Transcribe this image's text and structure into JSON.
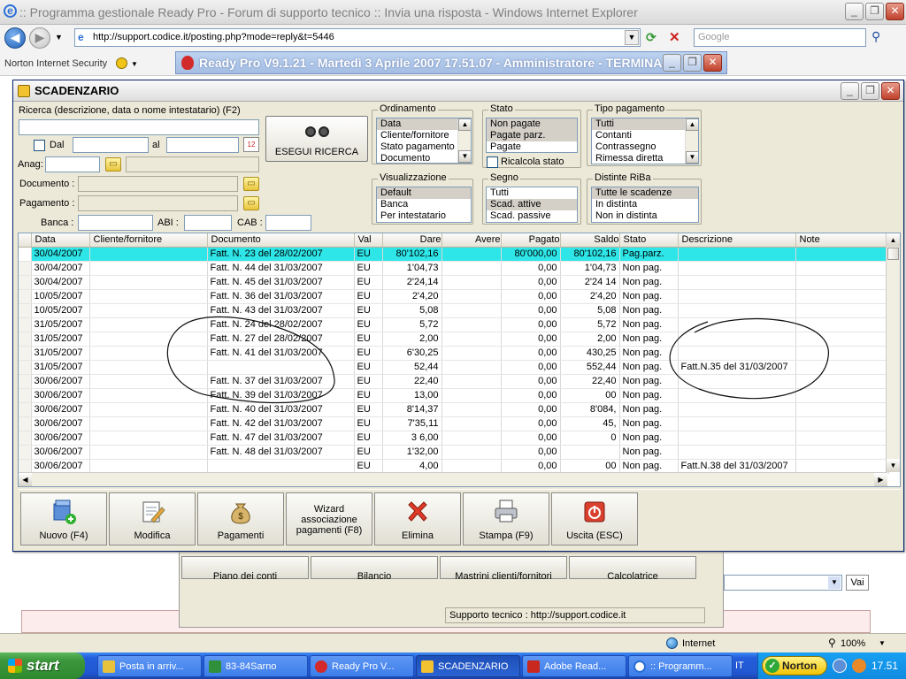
{
  "ie": {
    "title": ":: Programma gestionale Ready Pro - Forum di supporto tecnico :: Invia una risposta - Windows Internet Explorer",
    "url": "http://support.codice.it/posting.php?mode=reply&t=5446",
    "search_placeholder": "Google",
    "norton_label": "Norton Internet Security",
    "status_zone": "Internet",
    "zoom": "100%"
  },
  "readypro": {
    "title": "Ready Pro V9.1.21 - Martedì 3 Aprile 2007  17.51.07 - Amministratore - TERMINA...",
    "behind_buttons": [
      "Piano dei conti",
      "Bilancio",
      "Mastrini clienti/fornitori",
      "Calcolatrice"
    ],
    "support_text": "Supporto tecnico : http://support.codice.it",
    "vai_label": "Vai"
  },
  "window": {
    "title": "SCADENZARIO"
  },
  "filters": {
    "search_label": "Ricerca (descrizione, data o nome intestatario) (F2)",
    "dal_label": "Dal",
    "al_label": "al",
    "anag_label": "Anag:",
    "documento_label": "Documento :",
    "pagamento_label": "Pagamento :",
    "banca_label": "Banca :",
    "abi_label": "ABI :",
    "cab_label": "CAB :",
    "search_button": "ESEGUI RICERCA",
    "ricalcola_label": "Ricalcola stato"
  },
  "ordinamento": {
    "caption": "Ordinamento",
    "items": [
      "Data",
      "Cliente/fornitore",
      "Stato pagamento",
      "Documento"
    ],
    "selected": 0
  },
  "stato": {
    "caption": "Stato",
    "items": [
      "Non pagate",
      "Pagate parz.",
      "Pagate"
    ],
    "selected": [
      0,
      1
    ]
  },
  "tipo_pagamento": {
    "caption": "Tipo pagamento",
    "items": [
      "Tutti",
      "Contanti",
      "Contrassegno",
      "Rimessa diretta"
    ],
    "selected": 0
  },
  "visualizzazione": {
    "caption": "Visualizzazione",
    "items": [
      "Default",
      "Banca",
      "Per intestatario"
    ],
    "selected": 0
  },
  "segno": {
    "caption": "Segno",
    "items": [
      "Tutti",
      "Scad. attive",
      "Scad. passive"
    ],
    "selected": 1
  },
  "distinte": {
    "caption": "Distinte RiBa",
    "items": [
      "Tutte le scadenze",
      "In distinta",
      "Non in distinta"
    ],
    "selected": 0
  },
  "table": {
    "columns": [
      "Data",
      "Cliente/fornitore",
      "Documento",
      "Val",
      "Dare",
      "Avere",
      "Pagato",
      "Saldo",
      "Stato",
      "Descrizione",
      "Note"
    ],
    "rows": [
      {
        "data": "30/04/2007",
        "cliente": "",
        "doc": "Fatt. N. 23 del 28/02/2007",
        "val": "EU",
        "dare": "80'102,16",
        "avere": "",
        "pagato": "80'000,00",
        "saldo": "80'102,16",
        "stato": "Pag.parz.",
        "descr": "",
        "note": ""
      },
      {
        "data": "30/04/2007",
        "cliente": "",
        "doc": "Fatt. N. 44 del 31/03/2007",
        "val": "EU",
        "dare": "1'04,73",
        "avere": "",
        "pagato": "0,00",
        "saldo": "1'04,73",
        "stato": "Non pag.",
        "descr": "",
        "note": ""
      },
      {
        "data": "30/04/2007",
        "cliente": "",
        "doc": "Fatt. N. 45 del 31/03/2007",
        "val": "EU",
        "dare": "2'24,14",
        "avere": "",
        "pagato": "0,00",
        "saldo": "2'24 14",
        "stato": "Non pag.",
        "descr": "",
        "note": ""
      },
      {
        "data": "10/05/2007",
        "cliente": "",
        "doc": "Fatt. N. 36 del 31/03/2007",
        "val": "EU",
        "dare": "2'4,20",
        "avere": "",
        "pagato": "0,00",
        "saldo": "2'4,20",
        "stato": "Non pag.",
        "descr": "",
        "note": ""
      },
      {
        "data": "10/05/2007",
        "cliente": "",
        "doc": "Fatt. N. 43 del 31/03/2007",
        "val": "EU",
        "dare": "5,08",
        "avere": "",
        "pagato": "0,00",
        "saldo": "5,08",
        "stato": "Non pag.",
        "descr": "",
        "note": ""
      },
      {
        "data": "31/05/2007",
        "cliente": "",
        "doc": "Fatt. N. 24 del 28/02/2007",
        "val": "EU",
        "dare": "5,72",
        "avere": "",
        "pagato": "0,00",
        "saldo": "5,72",
        "stato": "Non pag.",
        "descr": "",
        "note": ""
      },
      {
        "data": "31/05/2007",
        "cliente": "",
        "doc": "Fatt. N. 27 del 28/02/2007",
        "val": "EU",
        "dare": "2,00",
        "avere": "",
        "pagato": "0,00",
        "saldo": "2,00",
        "stato": "Non pag.",
        "descr": "",
        "note": ""
      },
      {
        "data": "31/05/2007",
        "cliente": "",
        "doc": "Fatt. N. 41 del 31/03/2007",
        "val": "EU",
        "dare": "6'30,25",
        "avere": "",
        "pagato": "0,00",
        "saldo": "430,25",
        "stato": "Non pag.",
        "descr": "",
        "note": ""
      },
      {
        "data": "31/05/2007",
        "cliente": "",
        "doc": "",
        "val": "EU",
        "dare": "52,44",
        "avere": "",
        "pagato": "0,00",
        "saldo": "552,44",
        "stato": "Non pag.",
        "descr": "Fatt.N.35 del 31/03/2007",
        "note": ""
      },
      {
        "data": "30/06/2007",
        "cliente": "",
        "doc": "Fatt. N. 37 del 31/03/2007",
        "val": "EU",
        "dare": "22,40",
        "avere": "",
        "pagato": "0,00",
        "saldo": "22,40",
        "stato": "Non pag.",
        "descr": "",
        "note": ""
      },
      {
        "data": "30/06/2007",
        "cliente": "",
        "doc": "Fatt. N. 39 del 31/03/2007",
        "val": "EU",
        "dare": "13,00",
        "avere": "",
        "pagato": "0,00",
        "saldo": "00",
        "stato": "Non pag.",
        "descr": "",
        "note": ""
      },
      {
        "data": "30/06/2007",
        "cliente": "",
        "doc": "Fatt. N. 40 del 31/03/2007",
        "val": "EU",
        "dare": "8'14,37",
        "avere": "",
        "pagato": "0,00",
        "saldo": "8'084,",
        "stato": "Non pag.",
        "descr": "",
        "note": ""
      },
      {
        "data": "30/06/2007",
        "cliente": "",
        "doc": "Fatt. N. 42 del 31/03/2007",
        "val": "EU",
        "dare": "7'35,11",
        "avere": "",
        "pagato": "0,00",
        "saldo": "45,",
        "stato": "Non pag.",
        "descr": "",
        "note": ""
      },
      {
        "data": "30/06/2007",
        "cliente": "",
        "doc": "Fatt. N. 47 del 31/03/2007",
        "val": "EU",
        "dare": "3 6,00",
        "avere": "",
        "pagato": "0,00",
        "saldo": "0",
        "stato": "Non pag.",
        "descr": "",
        "note": ""
      },
      {
        "data": "30/06/2007",
        "cliente": "",
        "doc": "Fatt. N. 48 del 31/03/2007",
        "val": "EU",
        "dare": "1'32,00",
        "avere": "",
        "pagato": "0,00",
        "saldo": "",
        "stato": "Non pag.",
        "descr": "",
        "note": ""
      },
      {
        "data": "30/06/2007",
        "cliente": "",
        "doc": "",
        "val": "EU",
        "dare": "4,00",
        "avere": "",
        "pagato": "0,00",
        "saldo": "00",
        "stato": "Non pag.",
        "descr": "Fatt.N.38 del 31/03/2007",
        "note": ""
      }
    ],
    "highlight_row": 0,
    "highlight_color": "#2ee6e8"
  },
  "actions": [
    {
      "key": "nuovo",
      "label": "Nuovo (F4)",
      "icon": "new-document-icon"
    },
    {
      "key": "modifica",
      "label": "Modifica",
      "icon": "edit-document-icon"
    },
    {
      "key": "pagamenti",
      "label": "Pagamenti",
      "icon": "money-bag-icon"
    },
    {
      "key": "wizard",
      "label": "Wizard associazione pagamenti (F8)",
      "icon": ""
    },
    {
      "key": "elimina",
      "label": "Elimina",
      "icon": "delete-x-icon"
    },
    {
      "key": "stampa",
      "label": "Stampa (F9)",
      "icon": "printer-icon"
    },
    {
      "key": "uscita",
      "label": "Uscita (ESC)",
      "icon": "power-exit-icon"
    }
  ],
  "taskbar": {
    "start_label": "start",
    "tasks": [
      "Posta in arriv...",
      "83-84Sarno",
      "Ready Pro V...",
      "SCADENZARIO",
      "Adobe Read...",
      ":: Programm..."
    ],
    "active_task": 3,
    "lang": "IT",
    "norton": "Norton",
    "clock": "17.51"
  }
}
